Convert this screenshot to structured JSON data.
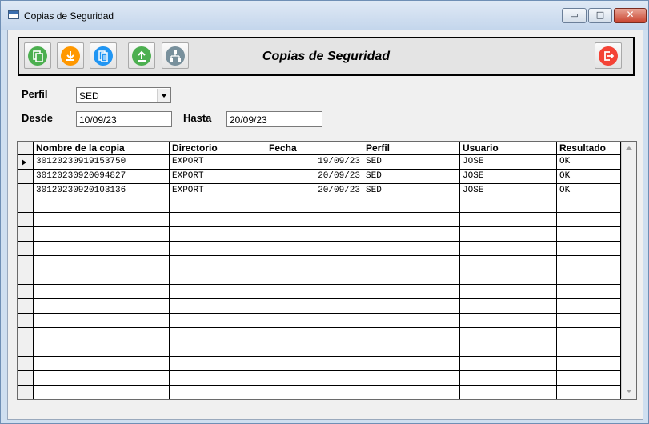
{
  "window": {
    "title": "Copias de Seguridad",
    "controls": {
      "minimize": "▭",
      "maximize": "□",
      "close": "✕"
    }
  },
  "toolbar": {
    "title": "Copias de Seguridad",
    "buttons": [
      {
        "name": "copy-button",
        "icon": "copy-icon",
        "color": "#4caf50"
      },
      {
        "name": "download-button",
        "icon": "download-icon",
        "color": "#ff9800"
      },
      {
        "name": "documents-button",
        "icon": "documents-icon",
        "color": "#2196f3"
      },
      {
        "name": "upload-button",
        "icon": "upload-icon",
        "color": "#4caf50"
      },
      {
        "name": "network-button",
        "icon": "network-icon",
        "color": "#78909c"
      },
      {
        "name": "exit-button",
        "icon": "exit-icon",
        "color": "#f44336"
      }
    ]
  },
  "filters": {
    "perfil_label": "Perfil",
    "perfil_value": "SED",
    "desde_label": "Desde",
    "desde_value": "10/09/23",
    "hasta_label": "Hasta",
    "hasta_value": "20/09/23"
  },
  "table": {
    "columns": [
      "Nombre de la copia",
      "Directorio",
      "Fecha",
      "Perfil",
      "Usuario",
      "Resultado"
    ],
    "rows": [
      [
        "30120230919153750",
        "EXPORT",
        "19/09/23",
        "SED",
        "JOSE",
        "OK"
      ],
      [
        "30120230920094827",
        "EXPORT",
        "20/09/23",
        "SED",
        "JOSE",
        "OK"
      ],
      [
        "30120230920103136",
        "EXPORT",
        "20/09/23",
        "SED",
        "JOSE",
        "OK"
      ]
    ],
    "selected_row": 0,
    "total_visible_rows": 17
  }
}
